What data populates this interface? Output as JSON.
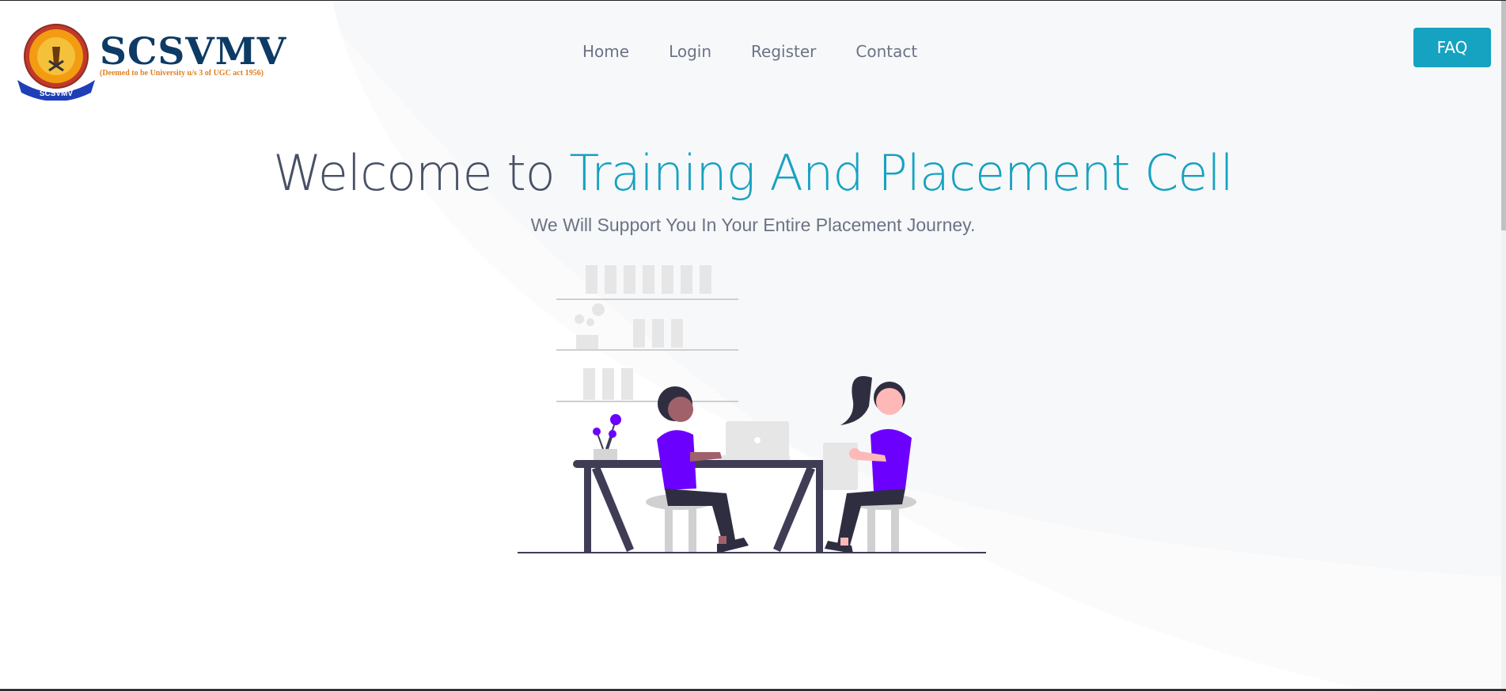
{
  "brand": {
    "name": "SCSVMV",
    "subtitle": "(Deemed to be University u/s 3 of UGC act 1956)",
    "seal_text": "SCSVMV"
  },
  "nav": {
    "items": [
      "Home",
      "Login",
      "Register",
      "Contact"
    ]
  },
  "faq_label": "FAQ",
  "hero": {
    "title_prefix": "Welcome to ",
    "title_highlight": "Training And Placement Cell",
    "subtitle": "We Will Support You In Your Entire Placement Journey."
  },
  "colors": {
    "accent": "#16a2c1",
    "brand_navy": "#0d3b66",
    "illustration_purple": "#6c00ff",
    "text_gray": "#6b7385"
  },
  "icons": [
    "university-seal",
    "people-at-desk-illustration"
  ]
}
